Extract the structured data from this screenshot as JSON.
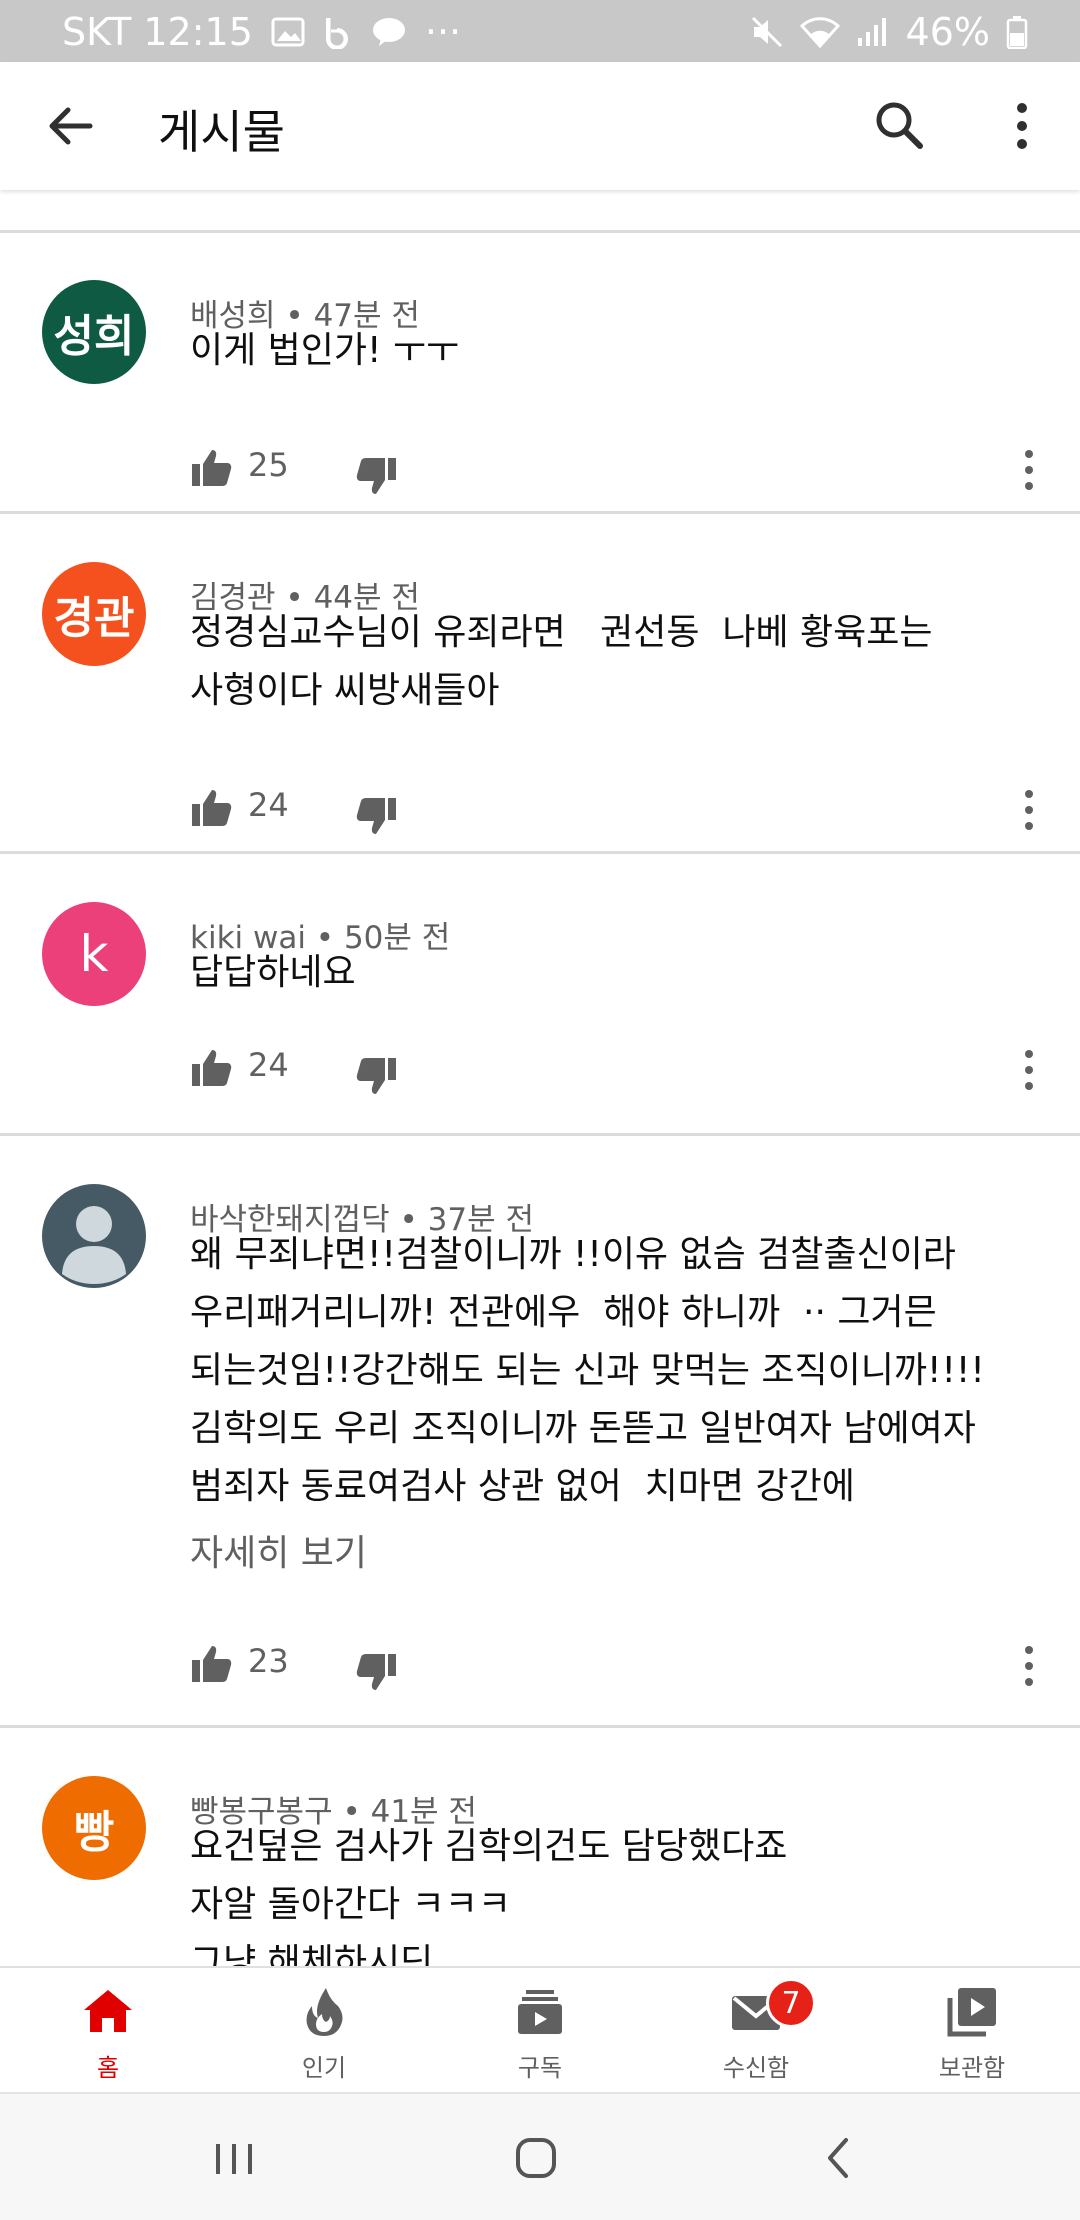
{
  "status_bar": {
    "carrier_time": "SKT 12:15",
    "dots": "···",
    "battery": "46%"
  },
  "app_bar": {
    "title": "게시물"
  },
  "comments": [
    {
      "avatar_text": "성희",
      "avatar_color": "#0f5a43",
      "author": "배성희",
      "time": "47분 전",
      "text": "이게 법인가! ㅜㅜ",
      "likes": "25"
    },
    {
      "avatar_text": "경관",
      "avatar_color": "#f4511e",
      "author": "김경관",
      "time": "44분 전",
      "text": "정경심교수님이 유죄라면   권선동  나베 황육포는 \n사형이다 씨방새들아",
      "likes": "24"
    },
    {
      "avatar_text": "k",
      "avatar_color": "#ec407a",
      "author": "kiki wai",
      "time": "50분 전",
      "text": "답답하네요",
      "likes": "24"
    },
    {
      "avatar_text": "",
      "avatar_color": "#455a64",
      "author": "바삭한돼지껍닥",
      "time": "37분 전",
      "text": "왜 무죄냐면!!검찰이니까 !!이유 없슴 검찰출신이라\n우리패거리니까! 전관에우  해야 하니까  ·· 그거믄\n되는것임!!강간해도 되는 신과 맞먹는 조직이니까!!!!\n김학의도 우리 조직이니까 돈뜯고 일반여자 남에여자\n범죄자 동료여검사 상관 없어  치마면 강간에",
      "read_more": "자세히 보기",
      "likes": "23"
    },
    {
      "avatar_text": "빵",
      "avatar_color": "#ef6c00",
      "author": "빵봉구봉구",
      "time": "41분 전",
      "text": "요건덮은 검사가 김학의건도 담당했다죠\n자알 돌아간다 ㅋㅋㅋ\n그냥 해체하시딘",
      "likes": ""
    }
  ],
  "bottom_nav": [
    {
      "label": "홈",
      "icon": "home-icon",
      "active": true
    },
    {
      "label": "인기",
      "icon": "trending-icon",
      "active": false
    },
    {
      "label": "구독",
      "icon": "subscriptions-icon",
      "active": false
    },
    {
      "label": "수신함",
      "icon": "inbox-icon",
      "active": false,
      "badge": "7"
    },
    {
      "label": "보관함",
      "icon": "library-icon",
      "active": false
    }
  ],
  "colors": {
    "accent": "#e00000",
    "meta": "#606060",
    "divider": "#dcdcdc"
  }
}
